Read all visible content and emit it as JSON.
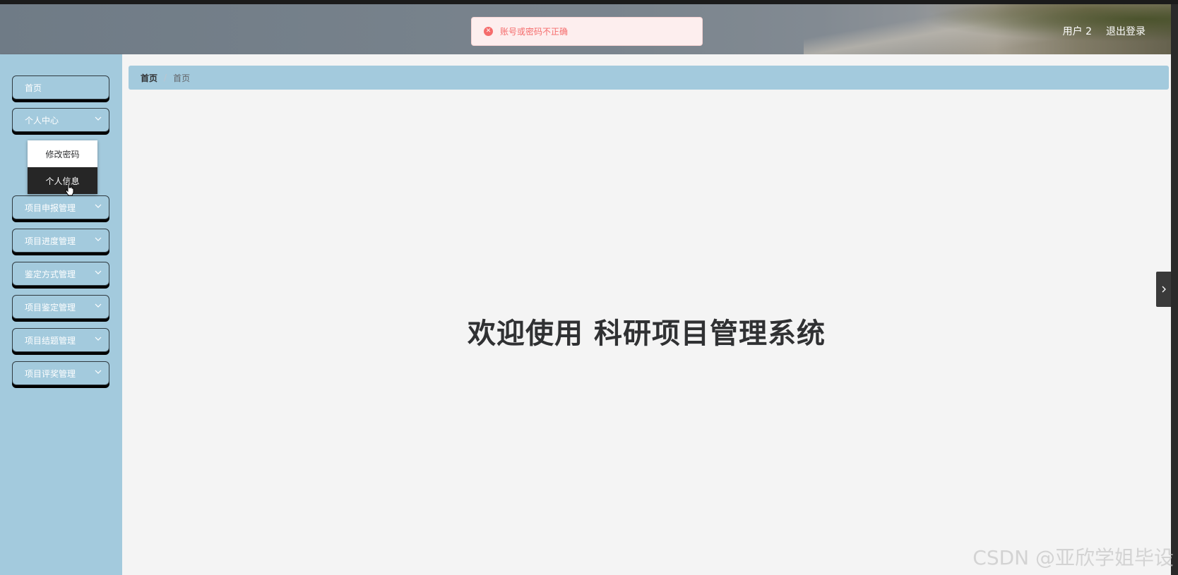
{
  "header": {
    "user_label": "用户 2",
    "logout_label": "退出登录"
  },
  "toast": {
    "icon": "error-circle-icon",
    "message": "账号或密码不正确",
    "color": "#f56c6c"
  },
  "sidebar": {
    "bg_color": "#a3cadd",
    "items": [
      {
        "label": "首页",
        "has_arrow": false
      },
      {
        "label": "个人中心",
        "has_arrow": true,
        "expanded": true
      },
      {
        "label": "项目申报管理",
        "has_arrow": true
      },
      {
        "label": "项目进度管理",
        "has_arrow": true
      },
      {
        "label": "鉴定方式管理",
        "has_arrow": true
      },
      {
        "label": "项目鉴定管理",
        "has_arrow": true
      },
      {
        "label": "项目结题管理",
        "has_arrow": true
      },
      {
        "label": "项目评奖管理",
        "has_arrow": true
      }
    ],
    "submenu": {
      "items": [
        {
          "label": "修改密码",
          "active": false
        },
        {
          "label": "个人信息",
          "active": true
        }
      ]
    }
  },
  "breadcrumb": {
    "home": "首页",
    "current": "首页"
  },
  "main": {
    "welcome": "欢迎使用 科研项目管理系统"
  },
  "watermark": "CSDN @亚欣学姐毕设"
}
